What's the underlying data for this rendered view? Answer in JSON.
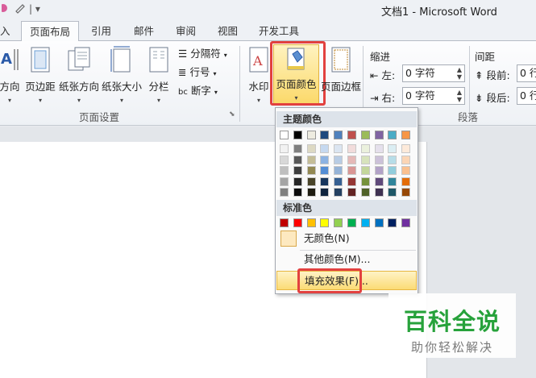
{
  "window": {
    "title": "文档1 - Microsoft Word",
    "quick_access": "| ▾"
  },
  "tabs": [
    {
      "label": "入"
    },
    {
      "label": "页面布局"
    },
    {
      "label": "引用"
    },
    {
      "label": "邮件"
    },
    {
      "label": "审阅"
    },
    {
      "label": "视图"
    },
    {
      "label": "开发工具"
    }
  ],
  "ribbon": {
    "page_setup": {
      "label": "页面设置",
      "buttons": {
        "orientation": "方向",
        "margins": "页边距",
        "orientation2": "纸张方向",
        "size": "纸张大小",
        "columns": "分栏"
      },
      "small": {
        "breaks": "分隔符",
        "line_numbers": "行号",
        "hyphenation": "断字"
      }
    },
    "page_background": {
      "watermark": "水印",
      "page_color": "页面颜色",
      "page_borders": "页面边框"
    },
    "paragraph": {
      "label": "段落",
      "indent": "缩进",
      "spacing": "间距",
      "left_label": "左:",
      "right_label": "右:",
      "left_value": "0 字符",
      "right_value": "0 字符",
      "before_label": "段前:",
      "after_label": "段后:",
      "before_value": "0 行",
      "after_value": "0 行"
    }
  },
  "dropdown": {
    "theme_colors_label": "主题颜色",
    "standard_colors_label": "标准色",
    "no_color": "无颜色(N)",
    "more_colors": "其他颜色(M)...",
    "fill_effects": "填充效果(F)...",
    "theme_top_row": [
      "#ffffff",
      "#000000",
      "#eeece1",
      "#1f497d",
      "#4f81bd",
      "#c0504d",
      "#9bbb59",
      "#8064a2",
      "#4bacc6",
      "#f79646"
    ],
    "theme_shades": [
      [
        "#f2f2f2",
        "#7f7f7f",
        "#ddd9c3",
        "#c6d9f0",
        "#dbe5f1",
        "#f2dcdb",
        "#ebf1dd",
        "#e5e0ec",
        "#dbeef3",
        "#fdeada"
      ],
      [
        "#d8d8d8",
        "#595959",
        "#c4bd97",
        "#8db3e2",
        "#b8cce4",
        "#e5b9b7",
        "#d7e3bc",
        "#ccc1d9",
        "#b7dde8",
        "#fbd5b5"
      ],
      [
        "#bfbfbf",
        "#3f3f3f",
        "#938953",
        "#548dd4",
        "#95b3d7",
        "#d99694",
        "#c3d69b",
        "#b2a2c7",
        "#92cddc",
        "#fac08f"
      ],
      [
        "#a5a5a5",
        "#262626",
        "#494429",
        "#17365d",
        "#366092",
        "#953734",
        "#76923c",
        "#5f497a",
        "#31859b",
        "#e36c09"
      ],
      [
        "#7f7f7f",
        "#0c0c0c",
        "#1d1b10",
        "#0f243e",
        "#244061",
        "#632423",
        "#4f6128",
        "#3f3151",
        "#205867",
        "#974806"
      ]
    ],
    "standard_colors": [
      "#c00000",
      "#ff0000",
      "#ffc000",
      "#ffff00",
      "#92d050",
      "#00b050",
      "#00b0f0",
      "#0070c0",
      "#002060",
      "#7030a0"
    ]
  },
  "watermark_logo": {
    "main": "百科全说",
    "sub": "助你轻松解决"
  }
}
